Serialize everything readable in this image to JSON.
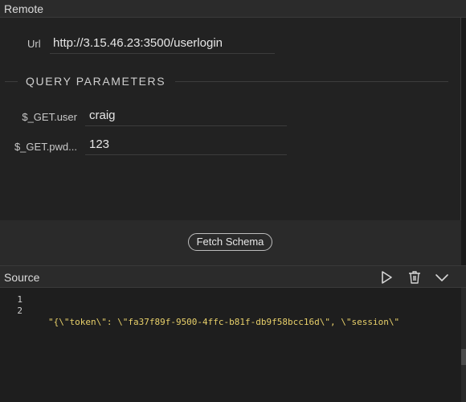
{
  "remote_panel": {
    "title": "Remote"
  },
  "url": {
    "label": "Url",
    "value": "http://3.15.46.23:3500/userlogin"
  },
  "query_parameters": {
    "title": "QUERY PARAMETERS",
    "params": [
      {
        "label": "$_GET.user",
        "value": "craig"
      },
      {
        "label": "$_GET.pwd...",
        "value": "123"
      }
    ]
  },
  "fetch_schema_label": "Fetch Schema",
  "source_panel": {
    "title": "Source",
    "icons": [
      "play-icon",
      "trash-icon",
      "chevron-down-icon"
    ],
    "line_numbers": [
      "1",
      "2"
    ],
    "lines": [
      "\"{\\\"token\\\": \\\"fa37f89f-9500-4ffc-b81f-db9f58bcc16d\\\", \\\"session\\\"",
      ""
    ]
  },
  "colors": {
    "code_string": "#e8d06a",
    "background": "#1e1e1e",
    "panel": "#222222"
  }
}
